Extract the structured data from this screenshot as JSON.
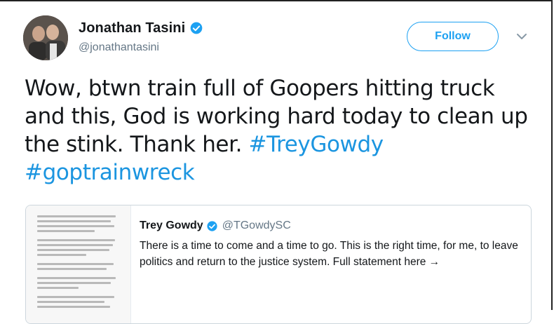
{
  "author": {
    "name": "Jonathan Tasini",
    "handle": "@jonathantasini",
    "verified": true
  },
  "follow_label": "Follow",
  "tweet": {
    "text_plain": "Wow, btwn train full of Goopers hitting truck and this, God is working hard today to clean up the stink. Thank her.",
    "hashtag1": "#TreyGowdy",
    "hashtag2": "#goptrainwreck"
  },
  "quoted": {
    "name": "Trey Gowdy",
    "handle": "@TGowdySC",
    "verified": true,
    "text": "There is a time to come and a time to go. This is the right time, for me, to leave politics and return to the justice system. Full statement here →"
  },
  "icons": {
    "verified": "verified-badge-icon",
    "chevron": "chevron-down-icon"
  },
  "colors": {
    "accent": "#1da1f2",
    "hashtag": "#1b95e0",
    "muted": "#657786"
  }
}
